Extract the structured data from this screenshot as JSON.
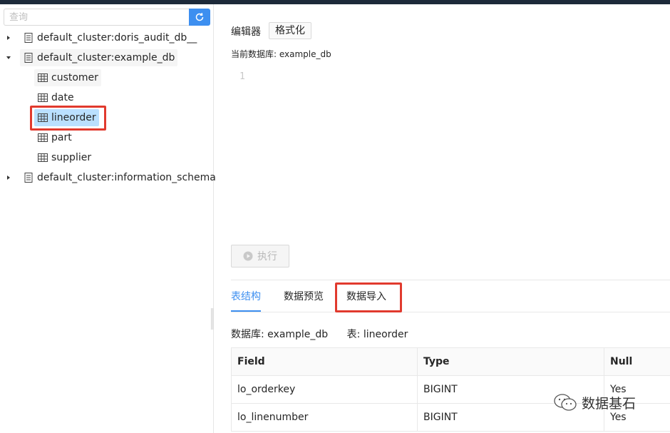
{
  "sidebar": {
    "search": {
      "placeholder": "查询",
      "value": ""
    },
    "tree": [
      {
        "label": "default_cluster:doris_audit_db__",
        "expanded": false
      },
      {
        "label": "default_cluster:example_db",
        "expanded": true,
        "children": [
          "customer",
          "date",
          "lineorder",
          "part",
          "supplier"
        ]
      },
      {
        "label": "default_cluster:information_schema",
        "expanded": false
      }
    ],
    "selected_table": "lineorder"
  },
  "editor": {
    "title": "编辑器",
    "format_label": "格式化",
    "current_db_label": "当前数据库: example_db",
    "line_number": "1",
    "run_label": "执行"
  },
  "tabs": [
    "表结构",
    "数据预览",
    "数据导入"
  ],
  "active_tab": "表结构",
  "meta": {
    "database": "数据库: example_db",
    "table": "表: lineorder"
  },
  "schema_table": {
    "columns": [
      "Field",
      "Type",
      "Null"
    ],
    "rows": [
      [
        "lo_orderkey",
        "BIGINT",
        "Yes"
      ],
      [
        "lo_linenumber",
        "BIGINT",
        "Yes"
      ]
    ]
  },
  "watermark": {
    "text": "数据基石"
  },
  "colors": {
    "accent": "#3d8ff0",
    "highlight_box": "#e13a2e",
    "selected_bg": "#bae0ff",
    "topbar": "#1d2a3a"
  }
}
